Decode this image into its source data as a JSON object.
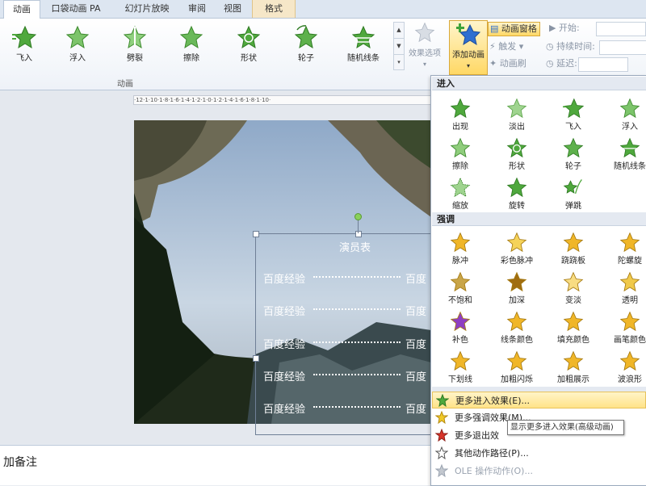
{
  "tabs": [
    {
      "label": "动画",
      "active": true
    },
    {
      "label": "口袋动画 PA",
      "active": false
    },
    {
      "label": "幻灯片放映",
      "active": false
    },
    {
      "label": "审阅",
      "active": false
    },
    {
      "label": "视图",
      "active": false
    },
    {
      "label": "格式",
      "active": false
    }
  ],
  "ribbon": {
    "animations": [
      "飞入",
      "浮入",
      "劈裂",
      "擦除",
      "形状",
      "轮子",
      "随机线条"
    ],
    "group_label": "动画",
    "effect_options": "效果选项",
    "add_animation": "添加动画",
    "animation_pane": "动画窗格",
    "trigger": "触发",
    "animation_painter": "动画刷",
    "start_label": "开始:",
    "duration_label": "持续时间:",
    "delay_label": "延迟:"
  },
  "slide": {
    "title": "演员表",
    "rows": [
      {
        "left": "百度经验",
        "right": "百度"
      },
      {
        "left": "百度经验",
        "right": "百度"
      },
      {
        "left": "百度经验",
        "right": "百度"
      },
      {
        "left": "百度经验",
        "right": "百度"
      },
      {
        "left": "百度经验",
        "right": "百度"
      }
    ]
  },
  "notes_placeholder": "加备注",
  "panel": {
    "entrance_title": "进入",
    "entrance": [
      {
        "label": "出现",
        "icon": "appear-star-icon"
      },
      {
        "label": "淡出",
        "icon": "fade-star-icon"
      },
      {
        "label": "飞入",
        "icon": "fly-in-star-icon"
      },
      {
        "label": "浮入",
        "icon": "float-in-star-icon"
      },
      {
        "label": "擦除",
        "icon": "wipe-star-icon"
      },
      {
        "label": "形状",
        "icon": "shape-star-icon"
      },
      {
        "label": "轮子",
        "icon": "wheel-star-icon"
      },
      {
        "label": "随机线条",
        "icon": "random-bars-star-icon"
      },
      {
        "label": "缩放",
        "icon": "zoom-star-icon"
      },
      {
        "label": "旋转",
        "icon": "spin-star-icon"
      },
      {
        "label": "弹跳",
        "icon": "bounce-star-icon"
      }
    ],
    "emphasis_title": "强调",
    "emphasis": [
      {
        "label": "脉冲",
        "icon": "pulse-star-icon"
      },
      {
        "label": "彩色脉冲",
        "icon": "color-pulse-star-icon"
      },
      {
        "label": "跷跷板",
        "icon": "teeter-star-icon"
      },
      {
        "label": "陀螺旋",
        "icon": "spin-gold-star-icon"
      },
      {
        "label": "不饱和",
        "icon": "desaturate-star-icon"
      },
      {
        "label": "加深",
        "icon": "darken-star-icon"
      },
      {
        "label": "变淡",
        "icon": "lighten-star-icon"
      },
      {
        "label": "透明",
        "icon": "transparency-star-icon"
      },
      {
        "label": "补色",
        "icon": "complementary-color-star-icon"
      },
      {
        "label": "线条颜色",
        "icon": "line-color-star-icon"
      },
      {
        "label": "填充颜色",
        "icon": "fill-color-star-icon"
      },
      {
        "label": "画笔颜色",
        "icon": "brush-color-star-icon"
      },
      {
        "label": "下划线",
        "icon": "underline-star-icon"
      },
      {
        "label": "加粗闪烁",
        "icon": "bold-flash-star-icon"
      },
      {
        "label": "加粗展示",
        "icon": "bold-reveal-star-icon"
      },
      {
        "label": "波浪形",
        "icon": "wave-star-icon"
      }
    ],
    "menu": [
      {
        "label": "更多进入效果(E)...",
        "icon": "green-star-icon",
        "hover": true,
        "dim": false
      },
      {
        "label": "更多强调效果(M)...",
        "icon": "yellow-star-icon",
        "hover": false,
        "dim": false
      },
      {
        "label": "更多退出效",
        "icon": "red-star-icon",
        "hover": false,
        "dim": false
      },
      {
        "label": "其他动作路径(P)...",
        "icon": "outline-star-icon",
        "hover": false,
        "dim": false
      },
      {
        "label": "OLE 操作动作(O)...",
        "icon": "gray-star-icon",
        "hover": false,
        "dim": true
      }
    ],
    "tooltip": "显示更多进入效果(高级动画)"
  },
  "colors": {
    "entrance_green": "#4fa83d",
    "emphasis_gold": "#f0b628",
    "accent_blue": "#2f6fd0"
  }
}
